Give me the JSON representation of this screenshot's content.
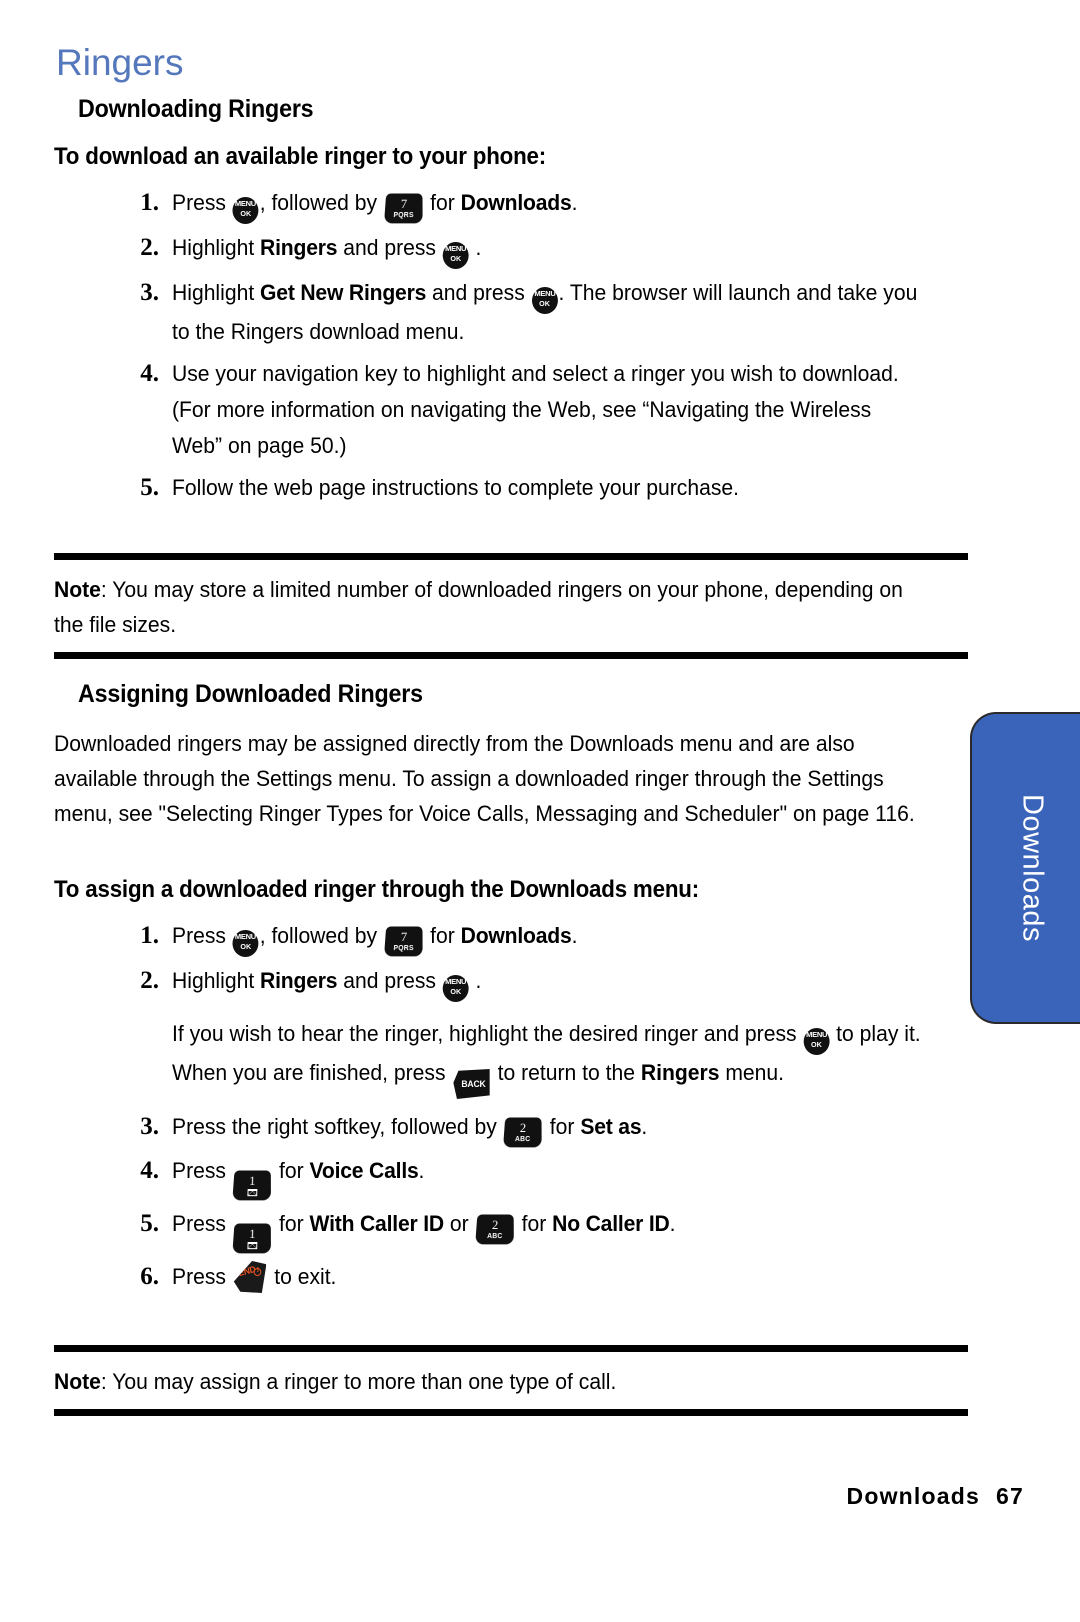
{
  "page": {
    "chapter_title": "Ringers",
    "side_tab_label": "Downloads",
    "footer_section": "Downloads",
    "footer_page_number": "67",
    "accent_blue": "#3a63ba",
    "title_blue": "#5577bb",
    "end_key_orange": "#e8521f"
  },
  "icons": {
    "menu_ok": {
      "name": "menu-ok-key-icon",
      "line1": "MENU",
      "line2": "OK"
    },
    "key7": {
      "name": "keypad-7-key-icon",
      "num": "7",
      "sub": "PQRS"
    },
    "key2": {
      "name": "keypad-2-key-icon",
      "num": "2",
      "sub": "ABC"
    },
    "key1": {
      "name": "keypad-1-key-icon",
      "num": "1",
      "sub": "envelope"
    },
    "back": {
      "name": "back-key-icon",
      "label": "BACK"
    },
    "end": {
      "name": "end-key-icon",
      "label": "END",
      "glyph": "power-symbol"
    }
  },
  "section1": {
    "heading": "Downloading Ringers",
    "subheading": "To download an available ringer to your phone:",
    "steps": [
      {
        "num": "1.",
        "parts": [
          {
            "t": "text",
            "v": "Press "
          },
          {
            "t": "icon",
            "v": "menu_ok"
          },
          {
            "t": "text",
            "v": ", followed by "
          },
          {
            "t": "icon",
            "v": "key7"
          },
          {
            "t": "text",
            "v": " for "
          },
          {
            "t": "bold",
            "v": "Downloads"
          },
          {
            "t": "text",
            "v": "."
          }
        ],
        "plain": "Press MENU/OK, followed by 7 PQRS for Downloads."
      },
      {
        "num": "2.",
        "parts": [
          {
            "t": "text",
            "v": "Highlight "
          },
          {
            "t": "bold",
            "v": "Ringers"
          },
          {
            "t": "text",
            "v": " and press "
          },
          {
            "t": "icon",
            "v": "menu_ok"
          },
          {
            "t": "text",
            "v": " ."
          }
        ],
        "plain": "Highlight Ringers and press MENU/OK ."
      },
      {
        "num": "3.",
        "parts": [
          {
            "t": "text",
            "v": "Highlight "
          },
          {
            "t": "bold",
            "v": "Get New Ringers"
          },
          {
            "t": "text",
            "v": " and press "
          },
          {
            "t": "icon",
            "v": "menu_ok"
          },
          {
            "t": "text",
            "v": ". The browser will launch and take you to the Ringers download menu."
          }
        ],
        "plain": "Highlight Get New Ringers and press MENU/OK. The browser will launch and take you to the Ringers download menu."
      },
      {
        "num": "4.",
        "parts": [
          {
            "t": "text",
            "v": "Use your navigation key to highlight and select a ringer you wish to download. (For more information on navigating the Web, see “Navigating the Wireless Web” on page 50.)"
          }
        ],
        "plain": "Use your navigation key to highlight and select a ringer you wish to download. (For more information on navigating the Web, see “Navigating the Wireless Web” on page 50.)"
      },
      {
        "num": "5.",
        "parts": [
          {
            "t": "text",
            "v": "Follow the web page instructions to complete your purchase."
          }
        ],
        "plain": "Follow the web page instructions to complete your purchase."
      }
    ],
    "note": {
      "label": "Note",
      "body": ": You may store a limited number of downloaded ringers on your phone, depending on the file sizes."
    }
  },
  "section2": {
    "heading": "Assigning Downloaded Ringers",
    "intro": "Downloaded ringers may be assigned directly from the Downloads menu and are also available through the Settings menu. To assign a downloaded ringer through the Settings menu, see \"Selecting Ringer Types for Voice Calls, Messaging and Scheduler\" on page 116.",
    "subheading": "To assign a downloaded ringer through the Downloads menu:",
    "steps": [
      {
        "num": "1.",
        "plain": "Press MENU/OK, followed by 7 PQRS for Downloads."
      },
      {
        "num": "2.",
        "plain": "Highlight Ringers and press MENU/OK ."
      },
      {
        "num": "3.",
        "plain": "Press the right softkey, followed by 2 ABC for Set as."
      },
      {
        "num": "4.",
        "plain": "Press 1 for Voice Calls."
      },
      {
        "num": "5.",
        "plain": "Press 1 for With Caller ID or 2 ABC for No Caller ID."
      },
      {
        "num": "6.",
        "plain": "Press END to exit."
      }
    ],
    "sub_paragraph": "If you wish to hear the ringer, highlight the desired ringer and press MENU/OK to play it. When you are finished, press BACK to return to the Ringers menu.",
    "note": {
      "label": "Note",
      "body": ": You may assign a ringer to more than one type of call."
    }
  },
  "text_fragments": {
    "press": "Press ",
    "followed_by": ", followed by ",
    "for": " for ",
    "downloads_bold": "Downloads",
    "period": ".",
    "highlight": "Highlight ",
    "ringers_bold": "Ringers",
    "and_press": " and press ",
    "space_period": " .",
    "get_new_ringers_bold": "Get New Ringers",
    "browser_tail": ". The browser will launch and take you to the Ringers download menu.",
    "step4_body": "Use your navigation key to highlight and select a ringer you wish to download. (For more information on navigating the Web, see “Navigating the Wireless Web” on page 50.)",
    "step5_body": "Follow the web page instructions to complete your purchase.",
    "sub_a": "If you wish to hear the ringer, highlight the desired ringer and press ",
    "sub_b": " to play it. When you are finished, press ",
    "sub_c": " to return to the ",
    "sub_ringers_bold": "Ringers",
    "sub_d": " menu.",
    "s3_a": "Press the right softkey, followed by ",
    "s3_setas_bold": "Set as",
    "s4_voicecalls_bold": "Voice Calls",
    "s5_withcaller_bold": "With Caller ID",
    "s5_or": " or ",
    "s5_nocaller_bold": "No Caller ID",
    "s6_tail": " to exit."
  }
}
